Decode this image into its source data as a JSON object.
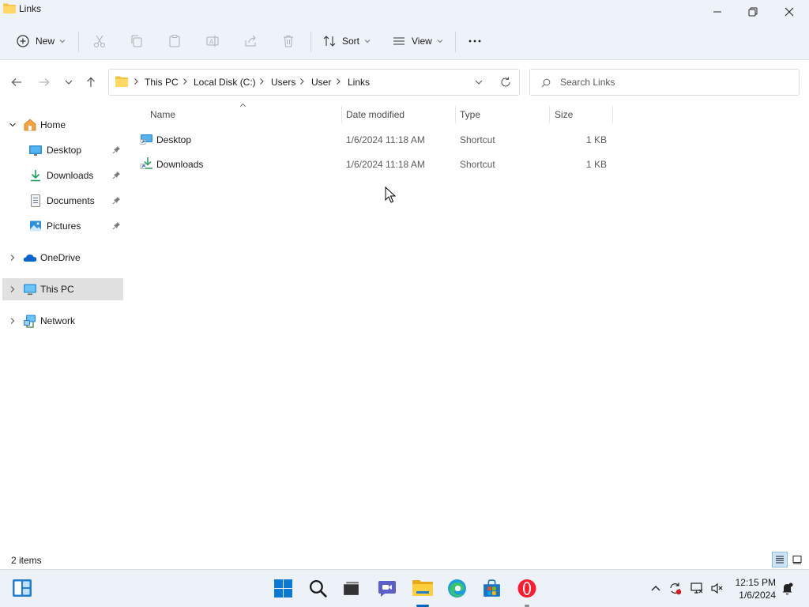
{
  "window": {
    "title": "Links"
  },
  "toolbar": {
    "new_label": "New",
    "sort_label": "Sort",
    "view_label": "View"
  },
  "breadcrumb": [
    "This PC",
    "Local Disk (C:)",
    "Users",
    "User",
    "Links"
  ],
  "search": {
    "placeholder": "Search Links"
  },
  "sidebar": {
    "home": "Home",
    "quick_access": [
      {
        "label": "Desktop",
        "icon": "desktop-icon"
      },
      {
        "label": "Downloads",
        "icon": "downloads-icon"
      },
      {
        "label": "Documents",
        "icon": "documents-icon"
      },
      {
        "label": "Pictures",
        "icon": "pictures-icon"
      }
    ],
    "onedrive": "OneDrive",
    "this_pc": "This PC",
    "network": "Network"
  },
  "columns": {
    "name": "Name",
    "date": "Date modified",
    "type": "Type",
    "size": "Size"
  },
  "files": [
    {
      "name": "Desktop",
      "date": "1/6/2024 11:18 AM",
      "type": "Shortcut",
      "size": "1 KB"
    },
    {
      "name": "Downloads",
      "date": "1/6/2024 11:18 AM",
      "type": "Shortcut",
      "size": "1 KB"
    }
  ],
  "status": {
    "item_count": "2 items"
  },
  "clock": {
    "time": "12:15 PM",
    "date": "1/6/2024"
  },
  "colors": {
    "accent": "#0067c0",
    "folder": "#f5c342",
    "selection": "#e1e1e1"
  }
}
